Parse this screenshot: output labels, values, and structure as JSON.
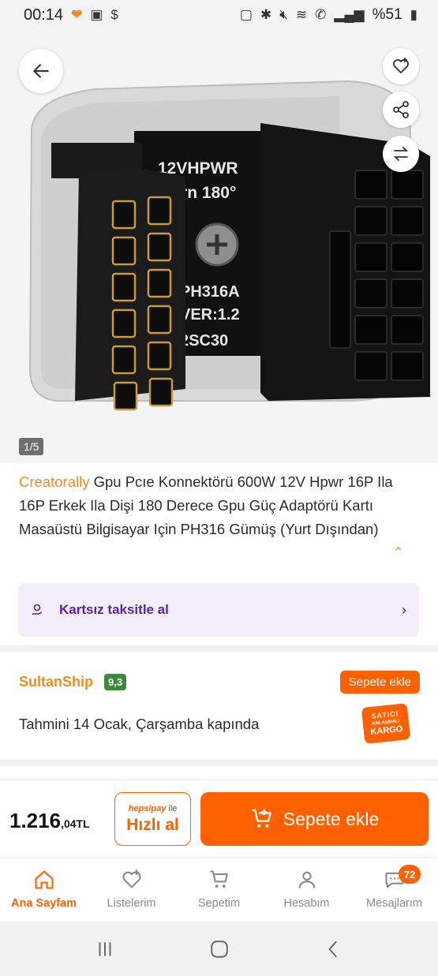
{
  "status_bar": {
    "time": "00:14",
    "battery": "%51"
  },
  "gallery": {
    "page_indicator": "1/5",
    "photo_text": [
      "12VHPWR",
      "Turn 180°",
      "PH316A",
      "VER:1.2",
      "2SC30"
    ]
  },
  "product": {
    "brand": "Creatorally",
    "title": " Gpu Pcıe Konnektörü 600W 12V Hpwr 16P Ila 16P Erkek Ila Dişi 180 Derece Gpu Güç Adaptörü Kartı Masaüstü Bilgisayar Için PH316 Gümüş (Yurt Dışından)"
  },
  "installment": {
    "label": "Kartsız taksitle al"
  },
  "seller": {
    "name": "SultanShip",
    "score": "9,3",
    "add_to_cart": "Sepete ekle",
    "delivery": "Tahmini 14 Ocak, Çarşamba kapında",
    "cargo_badge": [
      "SATICI",
      "ANLAŞMALI",
      "KARGO"
    ]
  },
  "buy_bar": {
    "price_main": "1.216",
    "price_sub": ",04TL",
    "hepsipay_brand": "hepsipay",
    "hepsipay_suffix": " ile",
    "fast_buy": "Hızlı al",
    "add_to_cart": "Sepete ekle"
  },
  "bottom_nav": {
    "items": [
      {
        "label": "Ana Sayfam",
        "icon": "home-icon",
        "active": true
      },
      {
        "label": "Listelerim",
        "icon": "heart-list-icon"
      },
      {
        "label": "Sepetim",
        "icon": "cart-icon"
      },
      {
        "label": "Hesabım",
        "icon": "user-icon"
      },
      {
        "label": "Mesajlarım",
        "icon": "message-icon",
        "badge": "72"
      }
    ]
  },
  "colors": {
    "accent": "#ff6000",
    "brand_text": "#f28b1c",
    "installment_purple": "#5b21a8",
    "score_green": "#3c8a3a"
  }
}
